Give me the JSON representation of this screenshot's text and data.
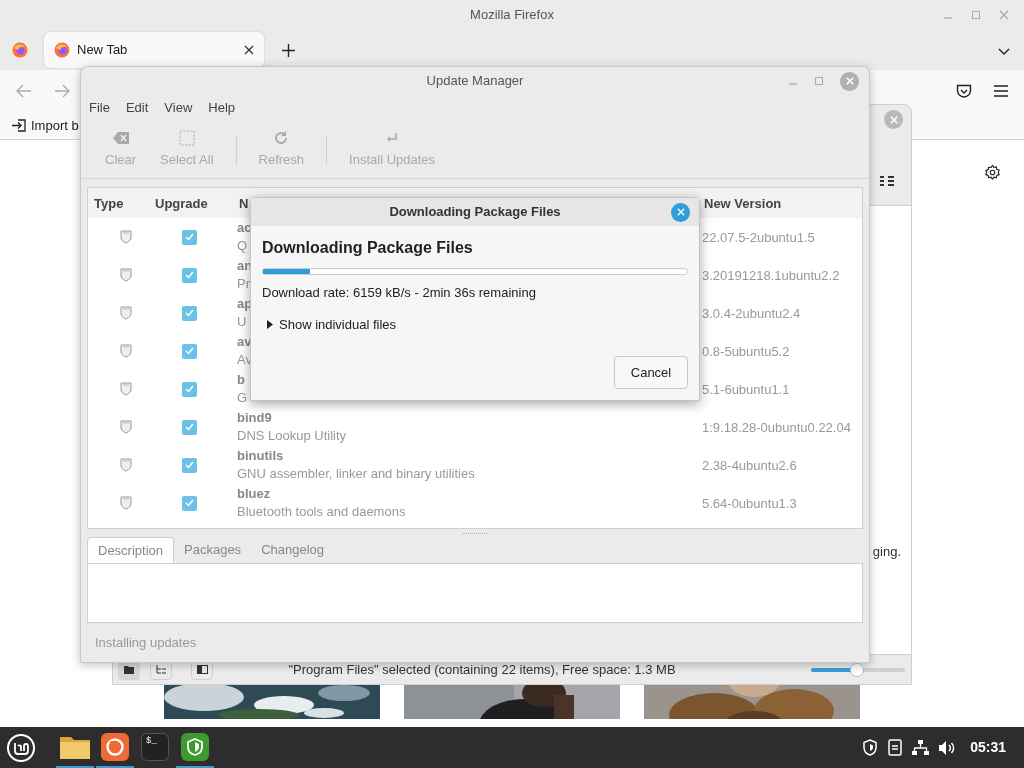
{
  "firefox": {
    "title": "Mozilla Firefox",
    "tabs": [
      {
        "kind": "pinned",
        "selected": false
      },
      {
        "kind": "page",
        "label": "New Tab",
        "selected": true
      }
    ],
    "bookmarks": [
      {
        "label": "Import b"
      }
    ]
  },
  "file_manager": {
    "content_fragment": "ging.",
    "status": "\"Program Files\" selected (containing 22 items), Free space: 1.3 MB",
    "zoom": {
      "level": 0.49
    }
  },
  "update_manager": {
    "title": "Update Manager",
    "menu": [
      "File",
      "Edit",
      "View",
      "Help"
    ],
    "toolbar": [
      {
        "kind": "clear",
        "label": "Clear",
        "disabled": true
      },
      {
        "kind": "select_all",
        "label": "Select All",
        "disabled": true
      },
      {
        "kind": "separator"
      },
      {
        "kind": "refresh",
        "label": "Refresh",
        "disabled": true
      },
      {
        "kind": "separator"
      },
      {
        "kind": "install",
        "label": "Install Updates",
        "disabled": true
      }
    ],
    "columns": [
      "Type",
      "Upgrade",
      "N",
      "New Version"
    ],
    "rows": [
      {
        "checked": true,
        "name": "ac",
        "description": "Q",
        "version": "22.07.5-2ubuntu1.5"
      },
      {
        "checked": true,
        "name": "an",
        "description": "Pr",
        "version": "3.20191218.1ubuntu2.2"
      },
      {
        "checked": true,
        "name": "ap",
        "description": "U",
        "version": "3.0.4-2ubuntu2.4"
      },
      {
        "checked": true,
        "name": "av",
        "description": "Av",
        "version": "0.8-5ubuntu5.2"
      },
      {
        "checked": true,
        "name": "b",
        "description": "G",
        "version": "5.1-6ubuntu1.1"
      },
      {
        "checked": true,
        "name": "bind9",
        "description": "DNS Lookup Utility",
        "version": "1:9.18.28-0ubuntu0.22.04"
      },
      {
        "checked": true,
        "name": "binutils",
        "description": "GNU assembler, linker and binary utilities",
        "version": "2.38-4ubuntu2.6"
      },
      {
        "checked": true,
        "name": "bluez",
        "description": "Bluetooth tools and daemons",
        "version": "5.64-0ubuntu1.3"
      }
    ],
    "tabs": [
      {
        "label": "Description",
        "selected": true
      },
      {
        "label": "Packages",
        "selected": false
      },
      {
        "label": "Changelog",
        "selected": false
      }
    ],
    "status": "Installing updates"
  },
  "dialog": {
    "title": "Downloading Package Files",
    "heading": "Downloading Package Files",
    "progress": {
      "level": 0.11
    },
    "rate": "Download rate: 6159 kB/s - 2min 36s remaining",
    "expander": {
      "label": "Show individual files",
      "expanded": false
    },
    "buttons": [
      "Cancel"
    ]
  },
  "taskbar": {
    "launchers": [
      {
        "kind": "files",
        "running": true
      },
      {
        "kind": "firefox",
        "running": true
      },
      {
        "kind": "terminal",
        "label": "$_",
        "running": false
      },
      {
        "kind": "shield",
        "running": true
      }
    ],
    "tray": [
      {
        "kind": "shield"
      },
      {
        "kind": "notes"
      },
      {
        "kind": "network"
      },
      {
        "kind": "volume"
      }
    ],
    "clock": "05:31"
  }
}
